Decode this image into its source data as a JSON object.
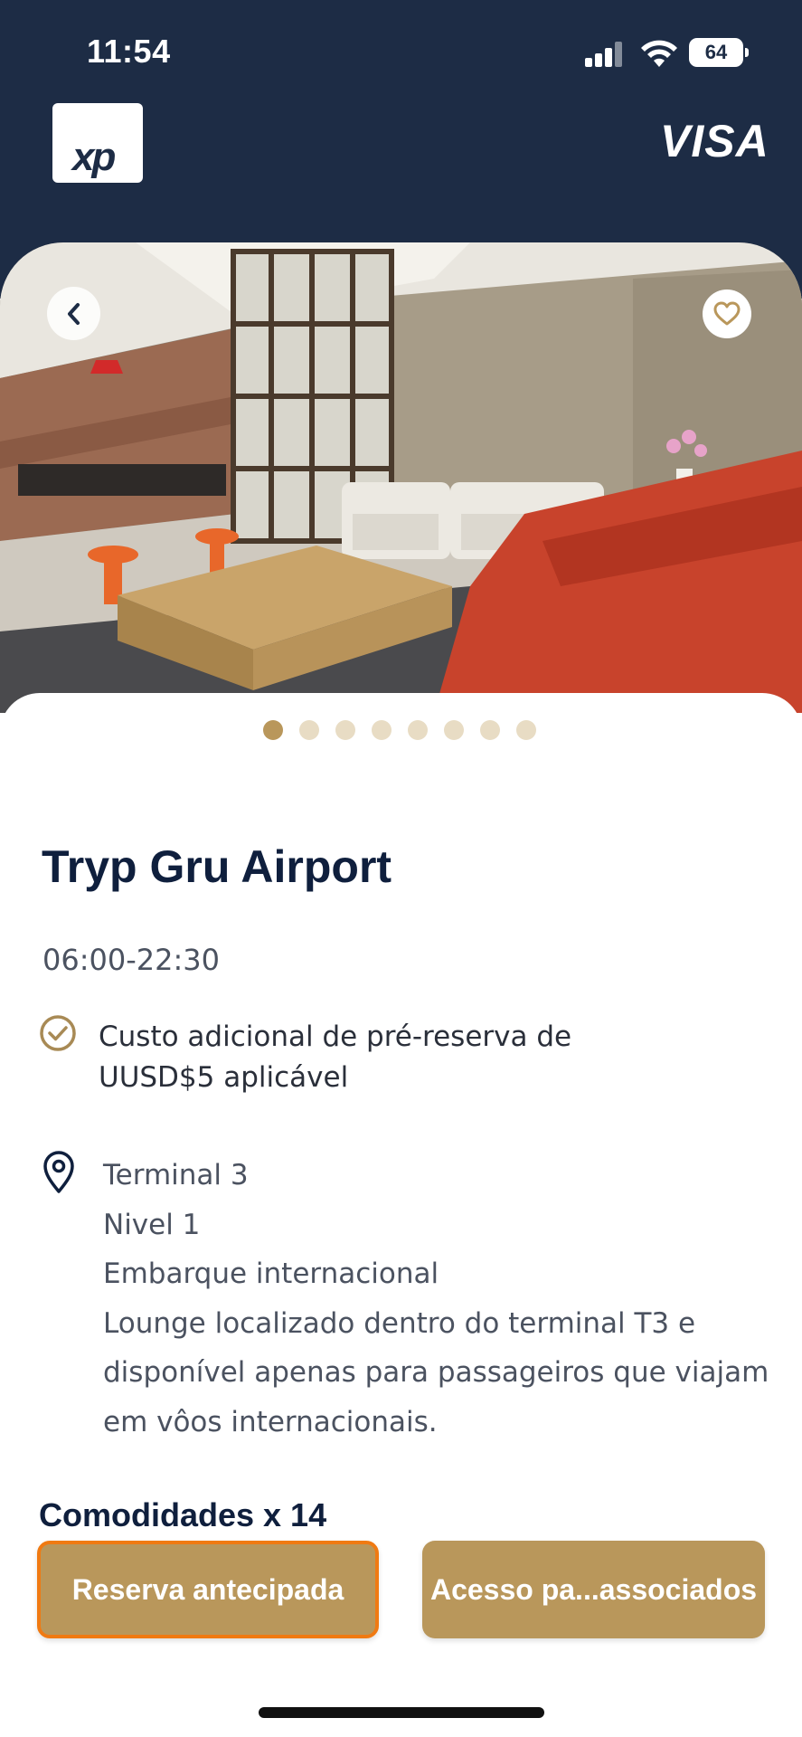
{
  "status_bar": {
    "time": "11:54",
    "battery": "64"
  },
  "brand": {
    "logo_text": "xp",
    "card_network": "VISA"
  },
  "gallery": {
    "total_images": 8,
    "active_index": 0
  },
  "lounge": {
    "name": "Tryp Gru Airport",
    "hours": "06:00-22:30",
    "notice_line1": "Custo adicional de pré-reserva de",
    "notice_line2": "UUSD$5 aplicável",
    "location_lines": [
      "Terminal 3",
      "Nivel 1",
      "Embarque internacional",
      "Lounge localizado dentro do terminal T3 e",
      "disponível apenas para passageiros que viajam",
      "em vôos internacionais."
    ]
  },
  "amenities": {
    "title": "Comodidades x 14",
    "chips": [
      "Reserva antecipada",
      "Acesso pa...associados"
    ]
  },
  "colors": {
    "header_bg": "#1d2c45",
    "accent_gold": "#b9975b",
    "dot_inactive": "#e8dcc4",
    "title_navy": "#0f1f3d",
    "focus_orange": "#f07a12"
  },
  "icons": {
    "back": "chevron-left-icon",
    "favorite": "heart-icon",
    "notice": "check-circle-icon",
    "location": "map-pin-icon"
  }
}
